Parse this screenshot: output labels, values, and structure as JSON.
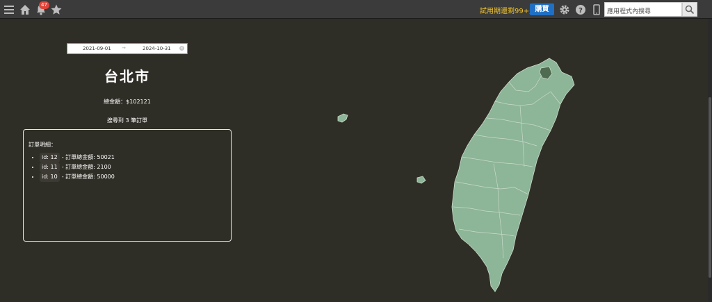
{
  "topbar": {
    "trial_text": "試用期還剩99+天",
    "buy_label": "購買",
    "search_placeholder": "應用程式內搜尋",
    "notification_count": "47",
    "icons": [
      "menu-icon",
      "home-icon",
      "bell-icon",
      "star-icon",
      "gear-icon",
      "help-icon",
      "mobile-icon",
      "search-icon"
    ]
  },
  "filter": {
    "start_date": "2021-09-01",
    "separator": "→",
    "end_date": "2024-10-31"
  },
  "summary": {
    "city": "台北市",
    "total_label": "總金額：$102121",
    "found_label": "搜尋到 3 筆訂單"
  },
  "orders": {
    "title": "訂單明細：",
    "items": [
      {
        "id_label": "id: 12",
        "text": "- 訂單總金額: 50021"
      },
      {
        "id_label": "id: 11",
        "text": "- 訂單總金額: 2100"
      },
      {
        "id_label": "id: 10",
        "text": "- 訂單總金額: 50000"
      }
    ]
  },
  "colors": {
    "background": "#2f2e26",
    "map_fill": "#8db597",
    "map_highlight": "#4f6b50",
    "accent_blue": "#1f6fc5",
    "trial_yellow": "#f0c22b"
  }
}
